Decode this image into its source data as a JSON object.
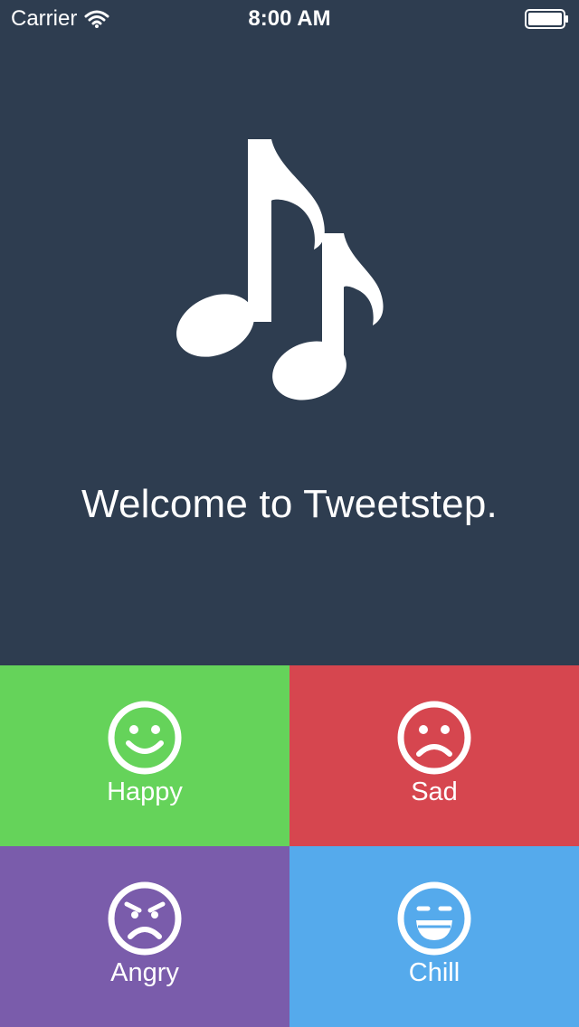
{
  "status_bar": {
    "carrier": "Carrier",
    "time": "8:00 AM",
    "wifi_icon": "wifi-icon",
    "battery_icon": "battery-icon"
  },
  "hero": {
    "icon": "music-notes-icon",
    "welcome_text": "Welcome to Tweetstep."
  },
  "colors": {
    "background": "#2e3d50",
    "happy": "#65d35a",
    "sad": "#d6464f",
    "angry": "#7a5cab",
    "chill": "#55aaec"
  },
  "moods": {
    "happy": {
      "label": "Happy",
      "icon": "smile-face-icon"
    },
    "sad": {
      "label": "Sad",
      "icon": "frown-face-icon"
    },
    "angry": {
      "label": "Angry",
      "icon": "angry-face-icon"
    },
    "chill": {
      "label": "Chill",
      "icon": "grin-face-icon"
    }
  }
}
